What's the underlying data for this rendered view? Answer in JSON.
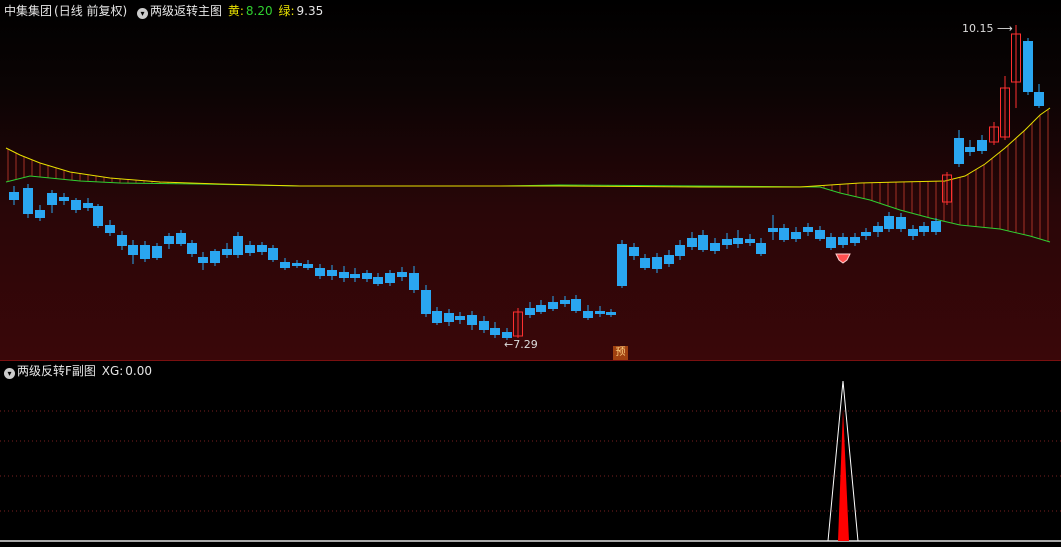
{
  "main_panel": {
    "stock_name": "中集集团",
    "period": "(日线 前复权)",
    "indicator_name": "两级返转主图",
    "yellow_label": "黄:",
    "yellow_value": "8.20",
    "green_label": "绿:",
    "green_value": "9.35",
    "high_marker": "10.15",
    "low_marker": "7.29",
    "forecast_badge": "预"
  },
  "sub_panel": {
    "indicator_name": "两级反转F副图",
    "xg_label": "XG:",
    "xg_value": "0.00"
  },
  "colors": {
    "up_candle": "#ff3030",
    "down_candle": "#2aa6f0",
    "yellow_line": "#e8e000",
    "green_line": "#30d030",
    "signal_red": "#ff0000"
  },
  "chart_data": {
    "type": "candlestick",
    "price_marks": {
      "high": 10.15,
      "low": 7.29
    },
    "legend": [
      {
        "name": "黄",
        "value": 8.2
      },
      {
        "name": "绿",
        "value": 9.35
      }
    ],
    "sub_indicator": {
      "name": "XG",
      "value": 0.0,
      "signal_spike_at_index": 82
    }
  }
}
